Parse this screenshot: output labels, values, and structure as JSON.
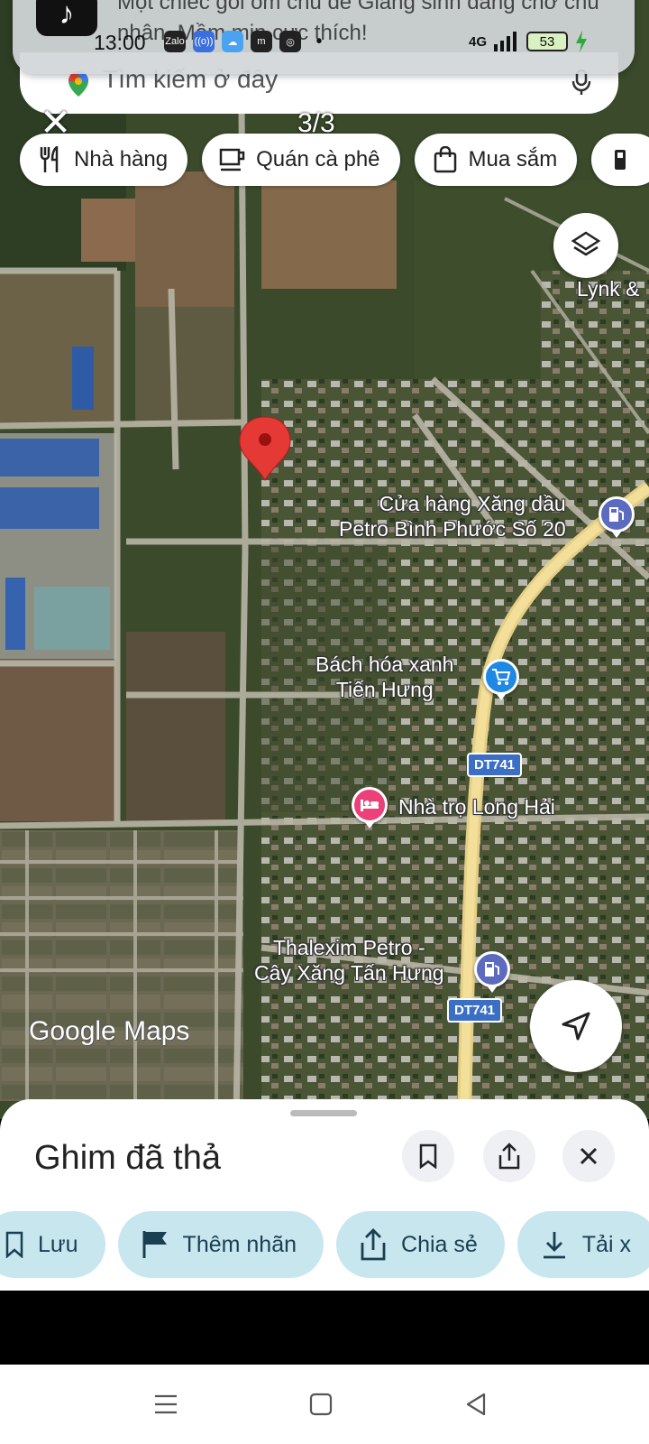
{
  "notification": {
    "app_icon": "tiktok-icon",
    "text": "Một chiếc gối ôm chú de Giáng sinh đang chờ chủ nhân. Mềm mịn cực thích!"
  },
  "status_bar": {
    "time": "13:00",
    "network": "4G",
    "battery": "53",
    "app_icons": [
      "Zalo",
      "((o))",
      "☁",
      "m",
      "◎",
      "•"
    ]
  },
  "search": {
    "placeholder": "Tìm kiếm ở đây",
    "logo": "maps-pin-icon",
    "mic": "mic-icon"
  },
  "viewer": {
    "close": "✕",
    "counter": "3/3"
  },
  "chips": [
    {
      "label": "Nhà hàng",
      "icon": "fork-knife-icon"
    },
    {
      "label": "Quán cà phê",
      "icon": "coffee-cup-icon"
    },
    {
      "label": "Mua sắm",
      "icon": "shopping-bag-icon"
    }
  ],
  "map": {
    "labels": {
      "lynk": "Lynk &",
      "petro": "Cửa hàng Xăng dầu\nPetro Bình Phước Số 20",
      "bachhoa": "Bách hóa xanh\nTiến Hưng",
      "nhatro": "Nhà trọ Long Hải",
      "thalexim": "Thalexim Petro -\nCây Xăng Tấn Hưng"
    },
    "road_badges": [
      "DT741",
      "DT741"
    ],
    "logo": "Google Maps"
  },
  "colors": {
    "pin": "#e53935",
    "gas": "#5c6bc0",
    "store": "#1e88e5",
    "hotel": "#ec407a",
    "action_bg": "#c7e6ee"
  },
  "sheet": {
    "title": "Ghim đã thả",
    "actions": [
      {
        "label": "Lưu",
        "icon": "bookmark-icon"
      },
      {
        "label": "Thêm nhãn",
        "icon": "flag-icon"
      },
      {
        "label": "Chia sẻ",
        "icon": "share-icon"
      },
      {
        "label": "Tải x",
        "icon": "download-icon"
      }
    ]
  }
}
